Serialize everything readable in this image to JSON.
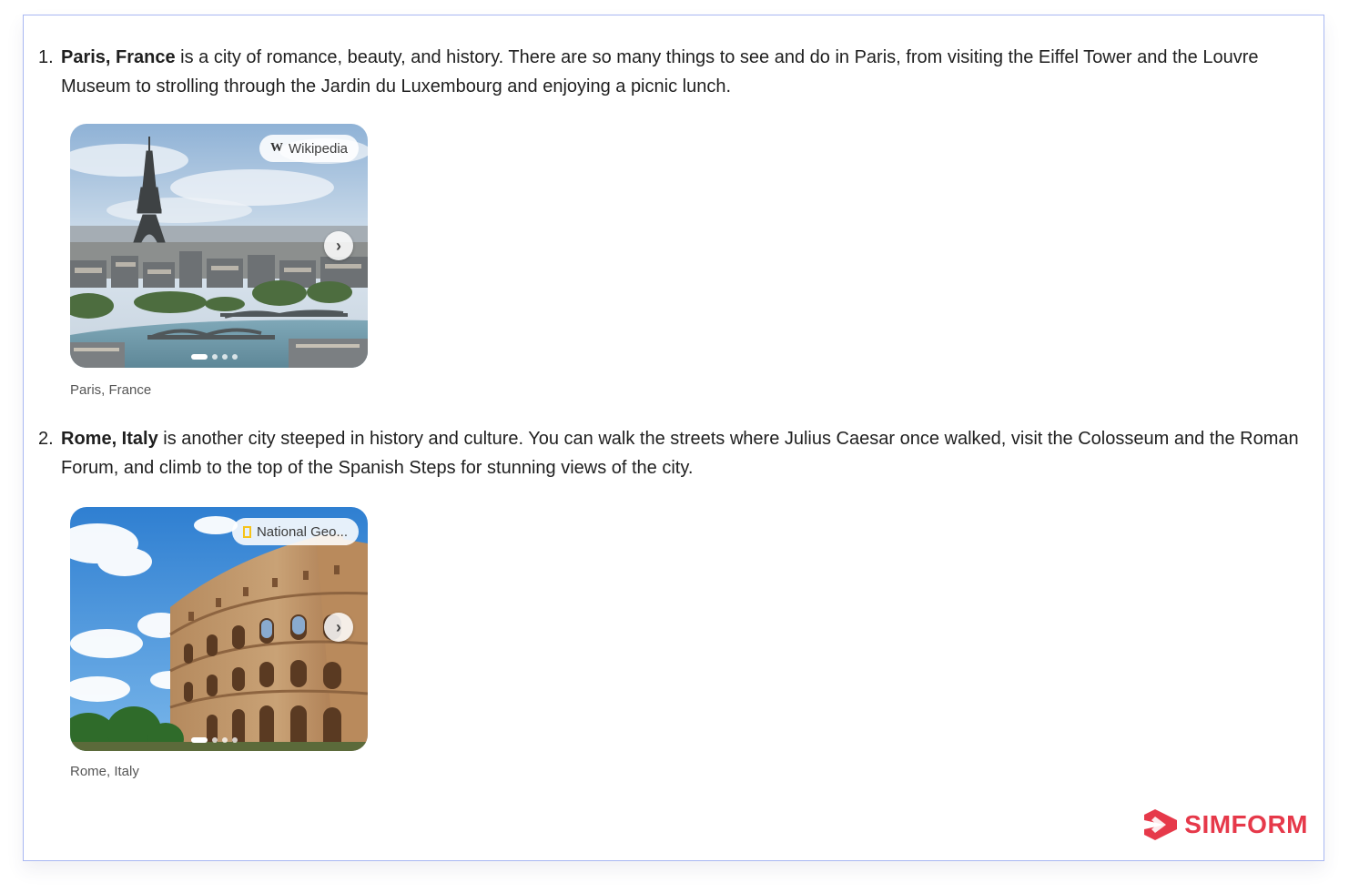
{
  "items": [
    {
      "number": "1.",
      "title": "Paris, France",
      "text": " is a city of romance, beauty, and history. There are so many things to see and do in Paris, from visiting the Eiffel Tower and the Louvre Museum to strolling through the Jardin du Luxembourg and enjoying a picnic lunch.",
      "source": "Wikipedia",
      "source_icon": "wikipedia-icon",
      "caption": "Paris, France"
    },
    {
      "number": "2.",
      "title": "Rome, Italy",
      "text": " is another city steeped in history and culture. You can walk the streets where Julius Caesar once walked, visit the Colosseum and the Roman Forum, and climb to the top of the Spanish Steps for stunning views of the city.",
      "source": "National Geo...",
      "source_icon": "national-geographic-icon",
      "caption": "Rome, Italy"
    }
  ],
  "brand": {
    "name": "SIMFORM",
    "color": "#e6394a"
  },
  "colors": {
    "frame_border": "#a9b8f2",
    "text": "#1f1f1f",
    "caption": "#555555"
  }
}
